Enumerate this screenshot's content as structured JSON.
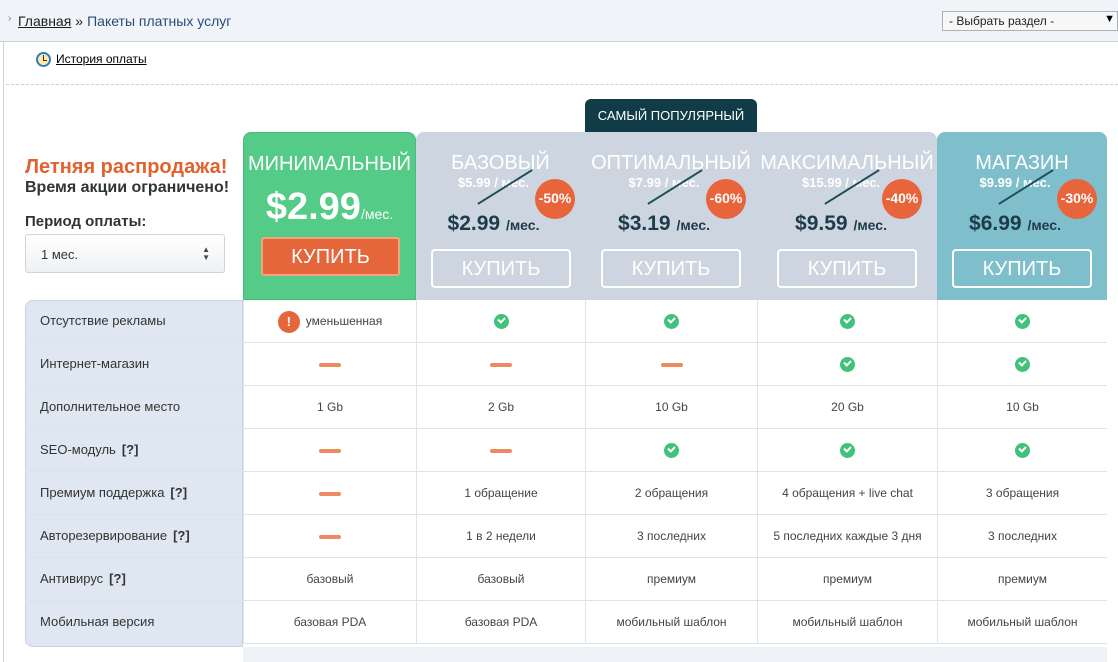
{
  "breadcrumb": {
    "home": "Главная",
    "separator": "»",
    "current": "Пакеты платных услуг"
  },
  "section_select": {
    "value": "- Выбрать раздел -"
  },
  "history_link": "История оплаты",
  "promo": {
    "title": "Летняя распродажа!",
    "subtitle": "Время акции ограничено!"
  },
  "period": {
    "label": "Период оплаты:",
    "value": "1 мес."
  },
  "popular_label": "САМЫЙ ПОПУЛЯРНЫЙ",
  "plans": [
    {
      "name": "МИНИМАЛЬНЫЙ",
      "price": "$2.99",
      "per": "/мес.",
      "buy": "КУПИТЬ"
    },
    {
      "name": "БАЗОВЫЙ",
      "old": "$5.99 / мес.",
      "price": "$2.99",
      "per": "/мес.",
      "discount": "-50%",
      "buy": "КУПИТЬ"
    },
    {
      "name": "ОПТИМАЛЬНЫЙ",
      "old": "$7.99 / мес.",
      "price": "$3.19",
      "per": "/мес.",
      "discount": "-60%",
      "buy": "КУПИТЬ"
    },
    {
      "name": "МАКСИМАЛЬНЫЙ",
      "old": "$15.99 / мес.",
      "price": "$9.59",
      "per": "/мес.",
      "discount": "-40%",
      "buy": "КУПИТЬ"
    },
    {
      "name": "МАГАЗИН",
      "old": "$9.99 / мес.",
      "price": "$6.99",
      "per": "/мес.",
      "discount": "-30%",
      "buy": "КУПИТЬ"
    }
  ],
  "features": [
    {
      "label": "Отсутствие рекламы",
      "help": "",
      "cells": [
        "!уменьшенная",
        "check",
        "check",
        "check",
        "check"
      ]
    },
    {
      "label": "Интернет-магазин",
      "help": "",
      "cells": [
        "dash",
        "dash",
        "dash",
        "check",
        "check"
      ]
    },
    {
      "label": "Дополнительное место",
      "help": "",
      "cells": [
        "1 Gb",
        "2 Gb",
        "10 Gb",
        "20 Gb",
        "10 Gb"
      ]
    },
    {
      "label": "SEO-модуль",
      "help": "[?]",
      "cells": [
        "dash",
        "dash",
        "check",
        "check",
        "check"
      ]
    },
    {
      "label": "Премиум поддержка",
      "help": "[?]",
      "cells": [
        "dash",
        "1 обращение",
        "2 обращения",
        "4 обращения + live chat",
        "3 обращения"
      ]
    },
    {
      "label": "Авторезервирование",
      "help": "[?]",
      "cells": [
        "dash",
        "1 в 2 недели",
        "3 последних",
        "5 последних каждые 3 дня",
        "3 последних"
      ]
    },
    {
      "label": "Антивирус",
      "help": "[?]",
      "cells": [
        "базовый",
        "базовый",
        "премиум",
        "премиум",
        "премиум"
      ]
    },
    {
      "label": "Мобильная версия",
      "help": "",
      "cells": [
        "базовая PDA",
        "базовая PDA",
        "мобильный шаблон",
        "мобильный шаблон",
        "мобильный шаблон"
      ]
    }
  ],
  "colors": {
    "accent": "#e5663a",
    "green": "#55cb88",
    "teal": "#7fbfcb",
    "grey": "#cdd5e1",
    "dark": "#103c47"
  }
}
